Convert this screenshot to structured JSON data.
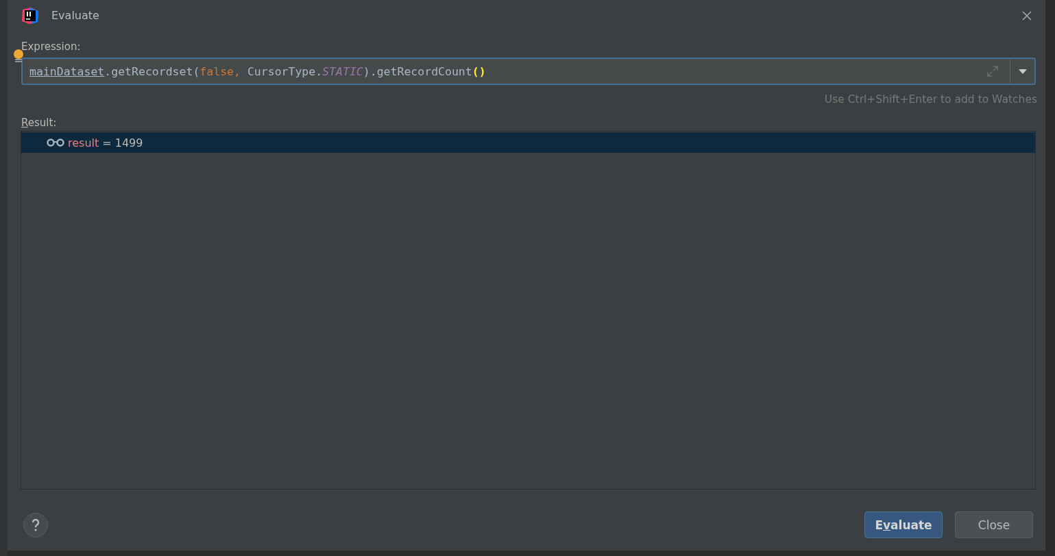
{
  "window": {
    "title": "Evaluate"
  },
  "expression": {
    "label": "Expression:",
    "tokens": [
      {
        "kind": "field",
        "text": "mainDataset"
      },
      {
        "kind": "plain",
        "text": ".getRecordset("
      },
      {
        "kind": "keyword",
        "text": "false,"
      },
      {
        "kind": "plain",
        "text": " CursorType."
      },
      {
        "kind": "constant",
        "text": "STATIC"
      },
      {
        "kind": "plain",
        "text": ").getRecordCount"
      },
      {
        "kind": "brace",
        "text": "()"
      }
    ],
    "hint": "Use Ctrl+Shift+Enter to add to Watches"
  },
  "result": {
    "label": {
      "mnemonic": "R",
      "after": "esult:"
    },
    "rows": [
      {
        "name": "result",
        "value": "= 1499",
        "selected": true
      }
    ]
  },
  "buttons": [
    {
      "before": "E",
      "mnemonic": "v",
      "after": "aluate",
      "kind": "primary"
    },
    {
      "before": "Close",
      "kind": "secondary"
    }
  ]
}
